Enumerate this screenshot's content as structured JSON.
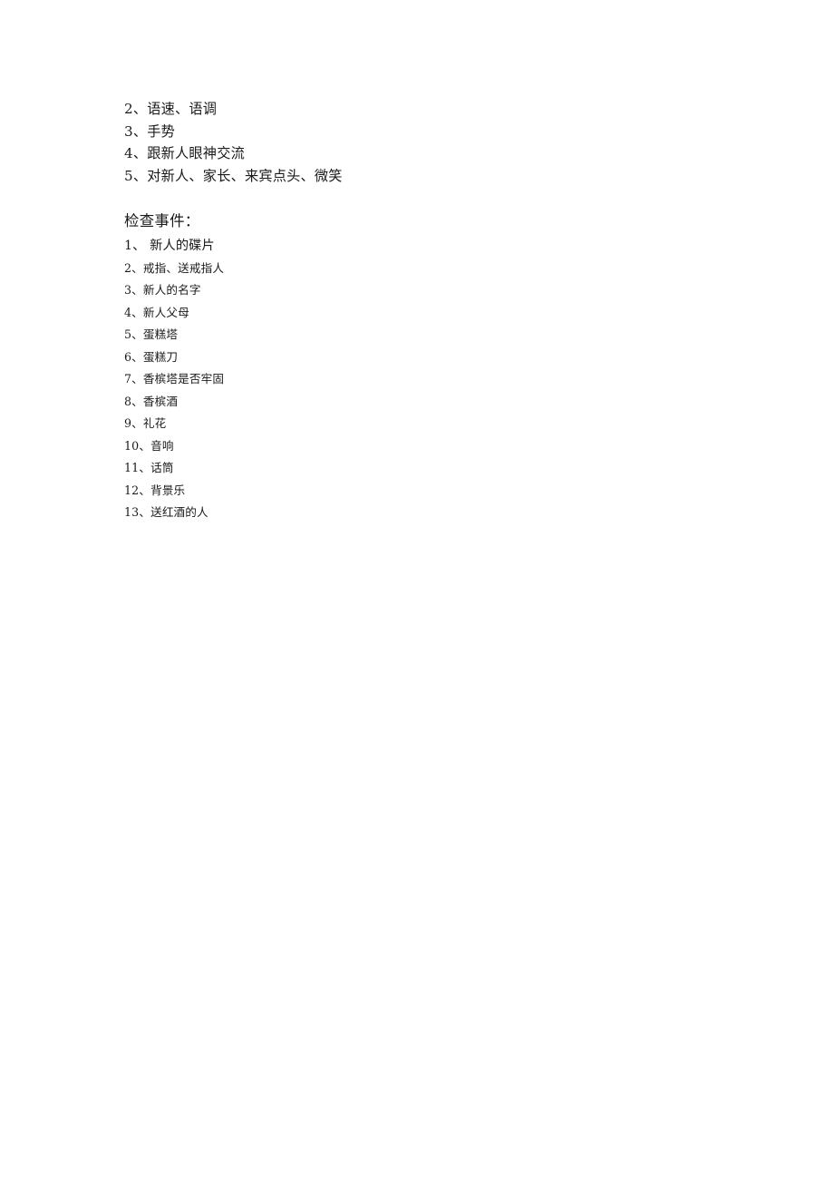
{
  "document": {
    "background_color": "#ffffff",
    "text_color": "#1a1a1a",
    "top_block": {
      "lines": [
        "2、语速、语调",
        "3、手势",
        "4、跟新人眼神交流",
        "5、对新人、家长、来宾点头、微笑"
      ]
    },
    "section": {
      "heading": "检查事件：",
      "items": [
        "1、 新人的碟片",
        "2、戒指、送戒指人",
        "3、新人的名字",
        "4、新人父母",
        "5、蛋糕塔",
        "6、蛋糕刀",
        "7、香槟塔是否牢固",
        "8、香槟酒",
        "9、礼花",
        "10、音响",
        "11、话筒",
        "12、背景乐",
        "13、送红酒的人"
      ]
    }
  }
}
